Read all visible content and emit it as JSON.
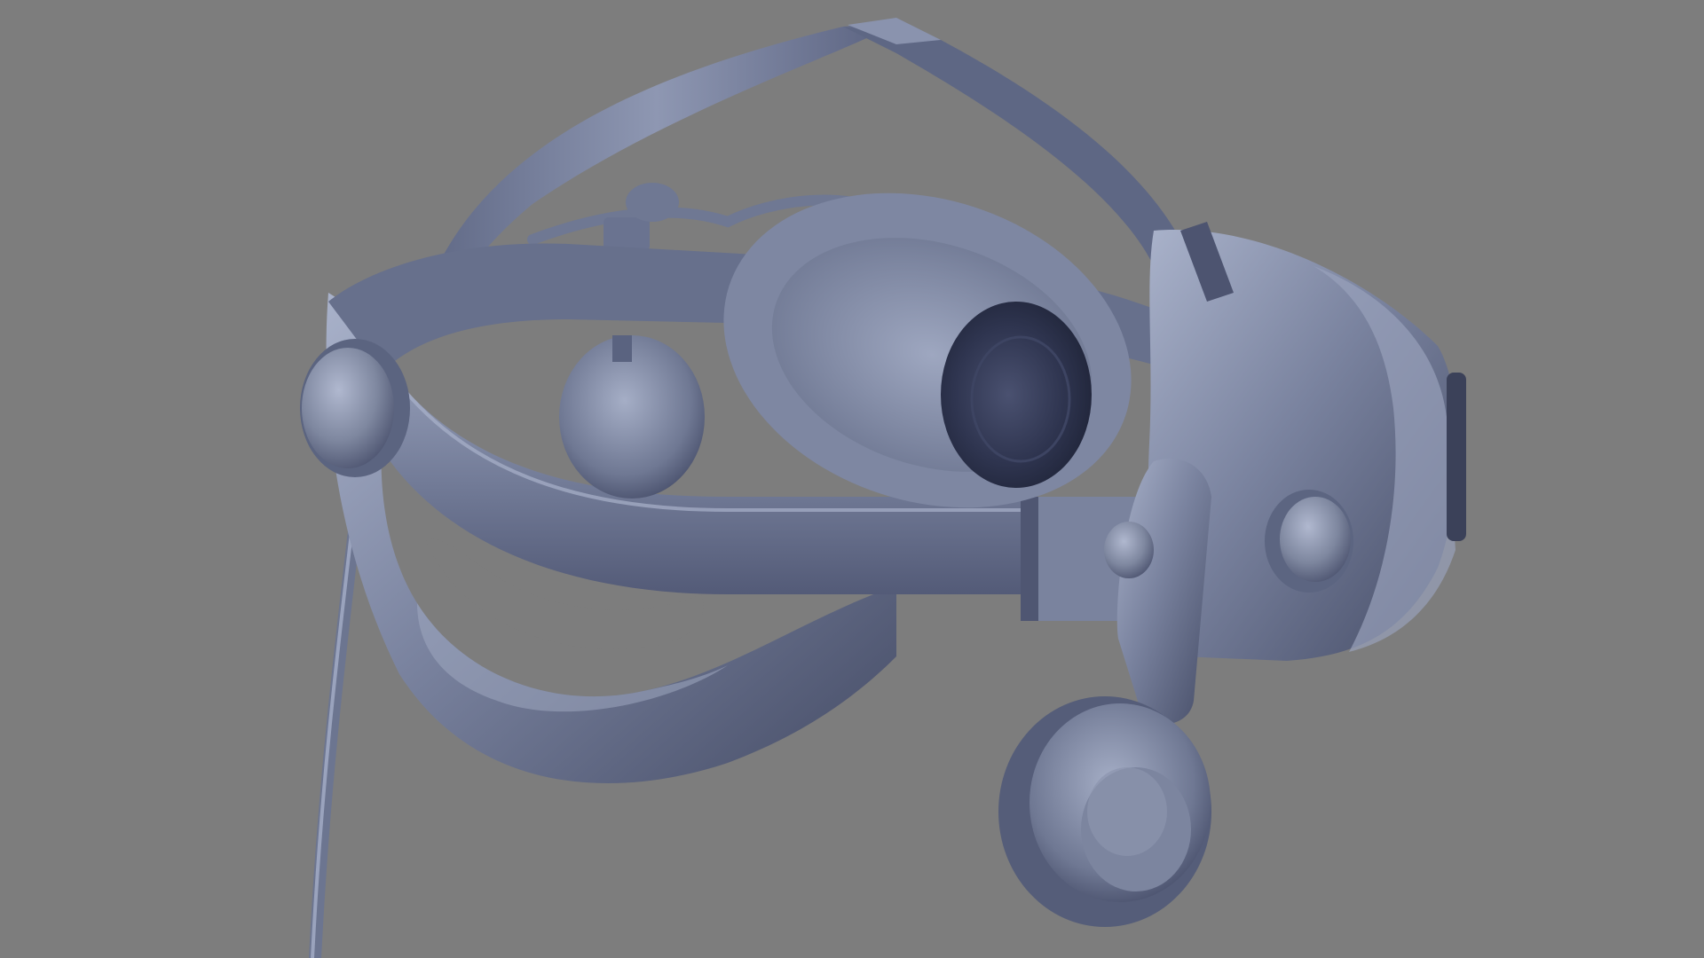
{
  "scene": {
    "subject": "vr-headset",
    "background_color": "#7d7d7d",
    "model_base_color": "#6f7893",
    "model_light_color": "#a7b0c8",
    "model_dark_color": "#3f4660",
    "render_style": "gray clay 3d render"
  }
}
